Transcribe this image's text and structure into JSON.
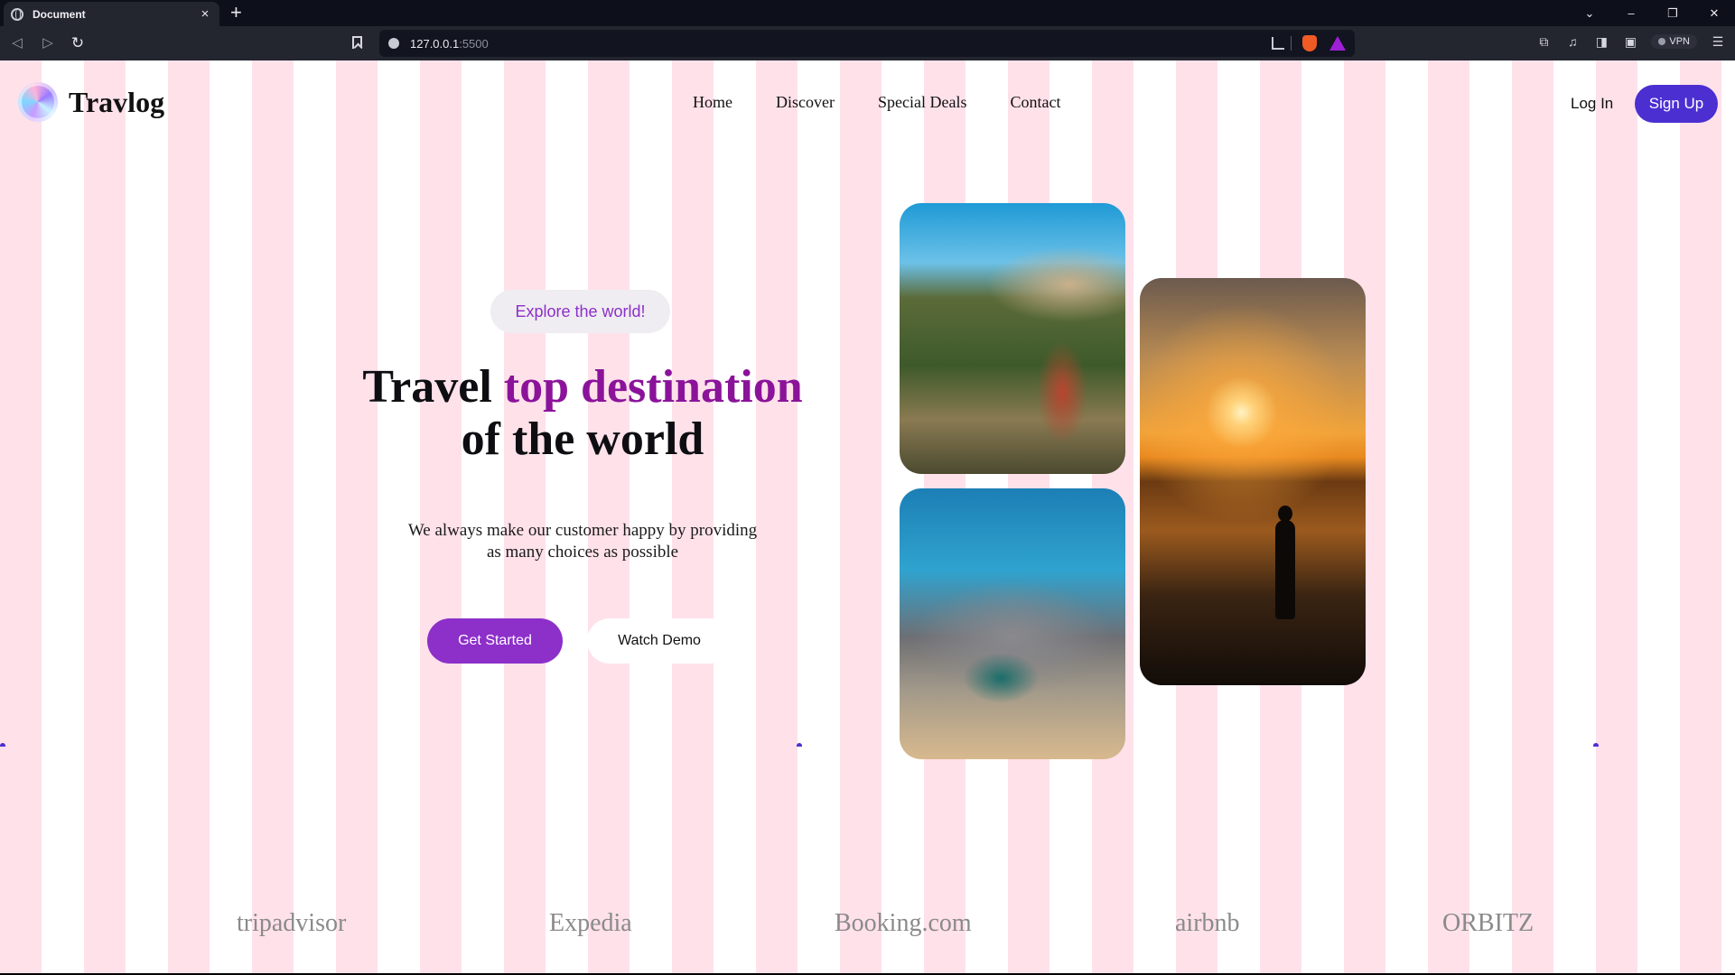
{
  "browser": {
    "tab_title": "Document",
    "tab_close": "×",
    "new_tab": "+",
    "url_host": "127.0.0.1",
    "url_port": ":5500",
    "vpn_label": "VPN",
    "window_controls": [
      "⌄",
      "–",
      "❐",
      "✕"
    ],
    "nav_back": "◁",
    "nav_forward": "▷",
    "nav_reload": "↻",
    "ext_icons": [
      "⧉",
      "♫",
      "◨",
      "▣",
      "☰"
    ],
    "brand_colors": {
      "brave": "#f05a24",
      "rewards": "#9e1fd6"
    }
  },
  "site": {
    "logo_text": "Travlog",
    "nav": [
      "Home",
      "Discover",
      "Special Deals",
      "Contact"
    ],
    "login_label": "Log In",
    "signup_label": "Sign Up",
    "accent_color": "#8d2fc9",
    "signup_color": "#4b2fd1"
  },
  "hero": {
    "pill_label": "Explore the world!",
    "headline_part1": "Travel ",
    "headline_accent": "top destination",
    "headline_part2": "of the world",
    "subtext_line1": "We always make our customer happy by providing",
    "subtext_line2": "as many choices as possible",
    "cta_primary": "Get Started",
    "cta_secondary": "Watch Demo"
  },
  "gallery": [
    {
      "name": "mountain-hiker-photo"
    },
    {
      "name": "rocky-coast-photo"
    },
    {
      "name": "sunset-surfer-photo"
    }
  ],
  "partners": [
    "tripadvisor",
    "Expedia",
    "Booking.com",
    "airbnb",
    "ORBITZ"
  ]
}
